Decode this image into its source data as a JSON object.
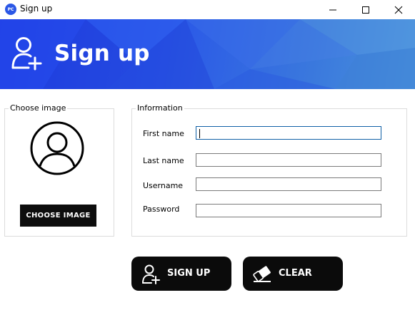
{
  "window": {
    "title": "Sign up",
    "app_icon_text": "PC"
  },
  "banner": {
    "title": "Sign up"
  },
  "image_group": {
    "legend": "Choose image",
    "button_label": "CHOOSE IMAGE"
  },
  "info_group": {
    "legend": "Information",
    "fields": [
      {
        "label": "First name",
        "value": "",
        "focused": true
      },
      {
        "label": "Last name",
        "value": ""
      },
      {
        "label": "Username",
        "value": ""
      },
      {
        "label": "Password",
        "value": ""
      }
    ]
  },
  "actions": {
    "signup_label": "SIGN UP",
    "clear_label": "CLEAR"
  },
  "colors": {
    "banner_start": "#1f3fe6",
    "banner_end": "#4a93dc",
    "button_bg": "#0b0b0b",
    "focus_border": "#0f5fa6"
  }
}
